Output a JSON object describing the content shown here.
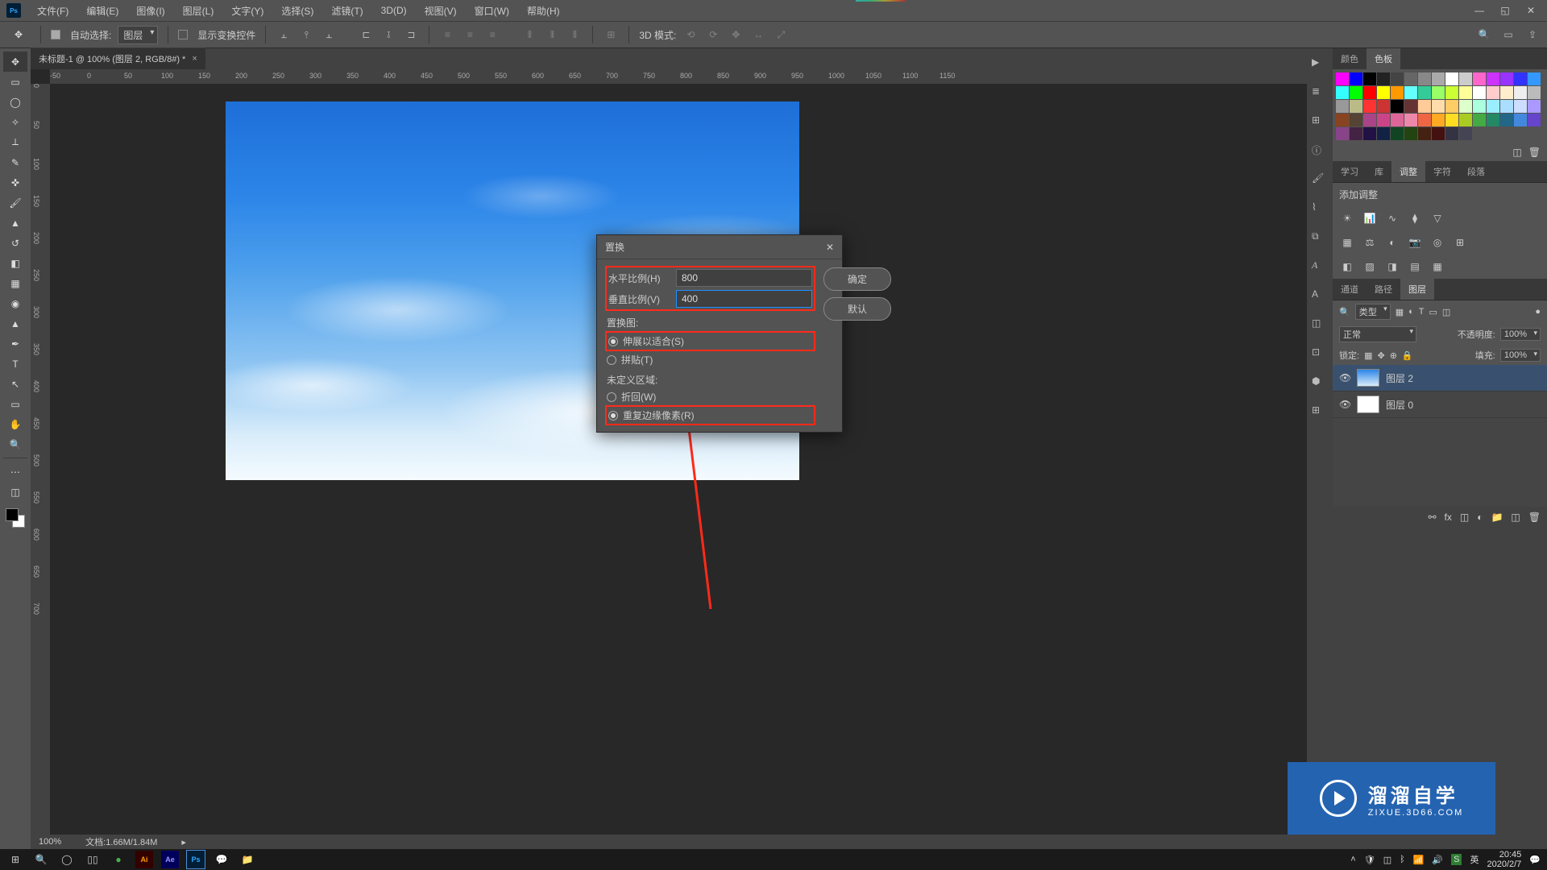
{
  "menubar": {
    "items": [
      "文件(F)",
      "编辑(E)",
      "图像(I)",
      "图层(L)",
      "文字(Y)",
      "选择(S)",
      "滤镜(T)",
      "3D(D)",
      "视图(V)",
      "窗口(W)",
      "帮助(H)"
    ]
  },
  "optionbar": {
    "autoSelect": "自动选择:",
    "layerDropdown": "图层",
    "showTransform": "显示变换控件",
    "mode3d": "3D 模式:"
  },
  "docTab": "未标题-1 @ 100% (图层 2, RGB/8#) *",
  "rulerH": [
    "-50",
    "0",
    "50",
    "100",
    "150",
    "200",
    "250",
    "300",
    "350",
    "400",
    "450",
    "500",
    "550",
    "600",
    "650",
    "700",
    "750",
    "800",
    "850",
    "900",
    "950",
    "1000",
    "1050",
    "1100",
    "1150"
  ],
  "rulerV": [
    "0",
    "50",
    "100",
    "150",
    "200",
    "250",
    "300",
    "350",
    "400",
    "450",
    "500",
    "550",
    "600",
    "650",
    "700"
  ],
  "dialog": {
    "title": "置换",
    "hLabel": "水平比例(H)",
    "hVal": "800",
    "vLabel": "垂直比例(V)",
    "vVal": "400",
    "mapLabel": "置换图:",
    "stretch": "伸展以适合(S)",
    "tile": "拼贴(T)",
    "undefLabel": "未定义区域:",
    "wrap": "折回(W)",
    "repeat": "重复边缘像素(R)",
    "ok": "确定",
    "default": "默认"
  },
  "status": {
    "zoom": "100%",
    "docinfo": "文档:1.66M/1.84M"
  },
  "panels": {
    "colorTab": "颜色",
    "swatchTab": "色板",
    "learnTab": "学习",
    "libTab": "库",
    "adjustTab": "调整",
    "charTab": "字符",
    "paraTab": "段落",
    "addAdjust": "添加调整",
    "chanTab": "通道",
    "pathTab": "路径",
    "layerTab": "图层",
    "kind": "类型",
    "blend": "正常",
    "opacity": "不透明度:",
    "opacityVal": "100%",
    "lock": "锁定:",
    "fill": "填充:",
    "fillVal": "100%",
    "layer2": "图层 2",
    "layer0": "图层 0"
  },
  "swatchColors": [
    "#ff00ff",
    "#0000ff",
    "#000000",
    "#222222",
    "#444444",
    "#666666",
    "#888888",
    "#aaaaaa",
    "#ffffff",
    "#cccccc",
    "#ff66cc",
    "#cc33ff",
    "#9933ff",
    "#3333ff",
    "#3399ff",
    "#33ffff",
    "#00ff00",
    "#ff0000",
    "#ffff00",
    "#ff9900",
    "#66ffff",
    "#33cc99",
    "#99ff66",
    "#ccff33",
    "#ffff99",
    "#ffffff",
    "#ffcccc",
    "#ffeecc",
    "#eeeeee",
    "#bbbbbb",
    "#999999",
    "#bbbb88",
    "#ff3333",
    "#cc3333",
    "#000000",
    "#663333",
    "#ffcc99",
    "#ffddaa",
    "#ffcc66",
    "#ddffcc",
    "#aaffdd",
    "#99eeff",
    "#aaddff",
    "#ccddff",
    "#aa99ff",
    "#884422",
    "#554433",
    "#aa4488",
    "#cc4488",
    "#dd6699",
    "#ee88aa",
    "#ee6644",
    "#ffaa22",
    "#ffdd22",
    "#aacc22",
    "#44aa44",
    "#228866",
    "#226688",
    "#4488dd",
    "#6644cc",
    "#884488",
    "#442244",
    "#221144",
    "#112244",
    "#114422",
    "#224411",
    "#442211",
    "#441111",
    "#333344",
    "#444455"
  ],
  "taskbar": {
    "time": "20:45",
    "date": "2020/2/7"
  },
  "watermark": {
    "brand": "溜溜自学",
    "url": "ZIXUE.3D66.COM"
  }
}
